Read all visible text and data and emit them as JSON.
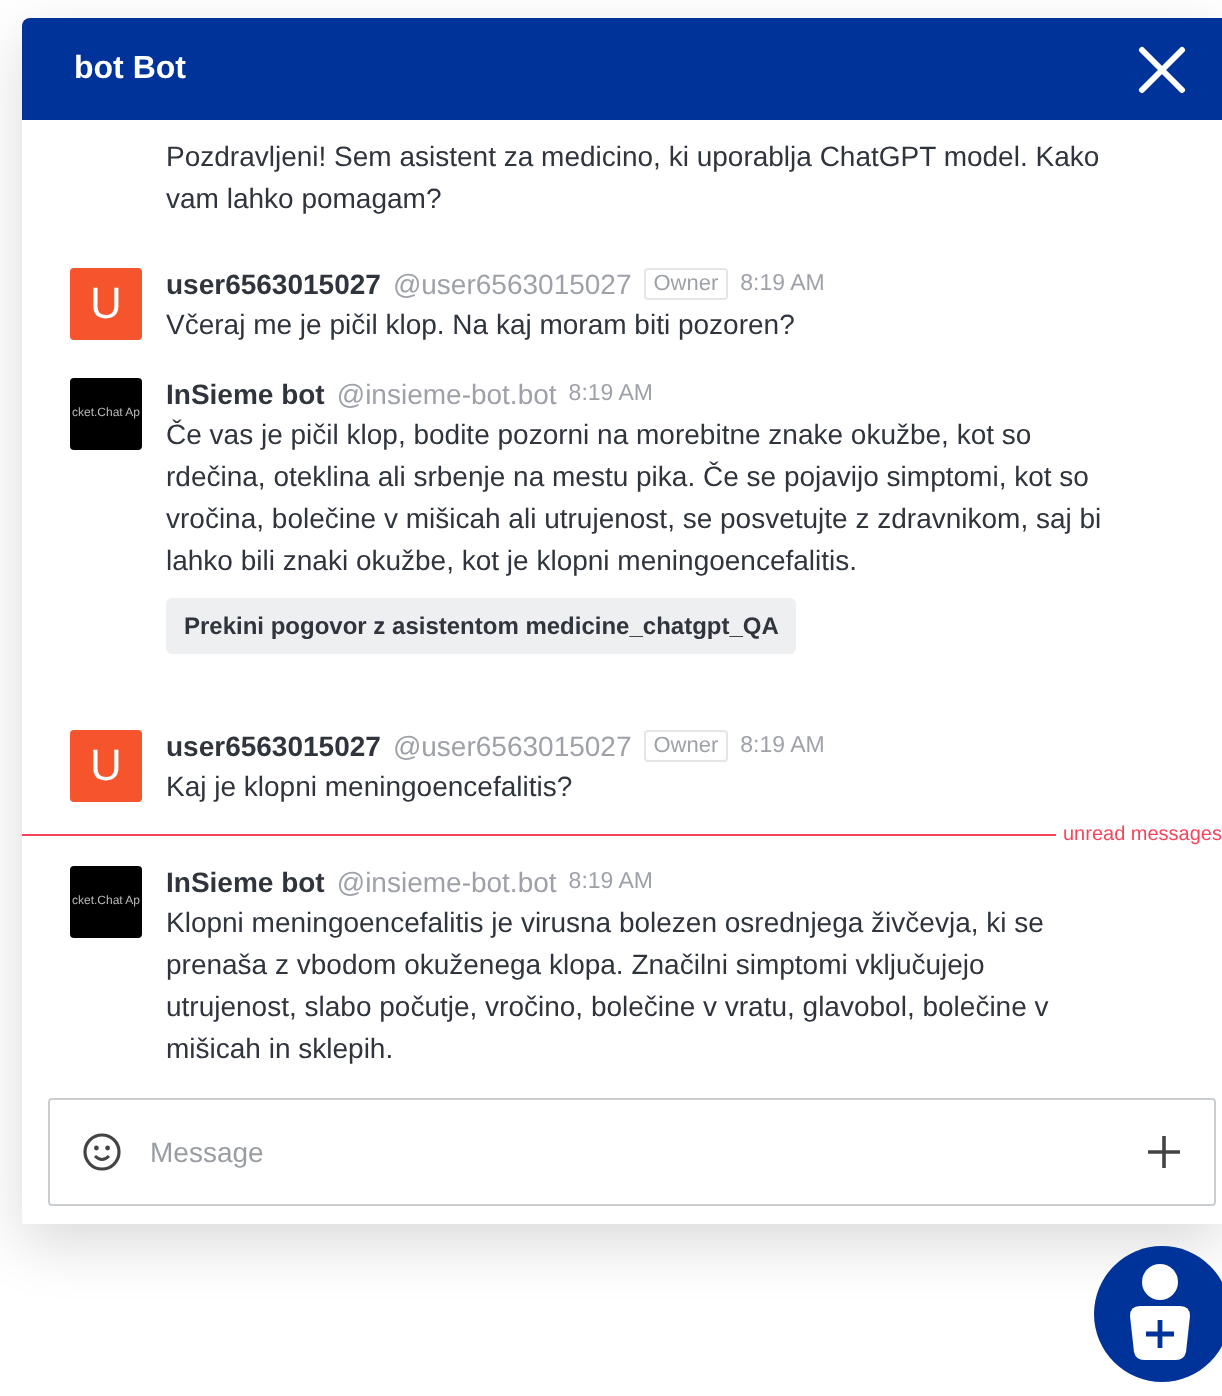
{
  "window": {
    "title": "bot Bot"
  },
  "messages": [
    {
      "kind": "continuation",
      "text": "Pozdravljeni! Sem asistent za medicino, ki uporablja ChatGPT model. Kako vam lahko pomagam?"
    },
    {
      "kind": "message",
      "avatar": {
        "kind": "letter",
        "text": "U"
      },
      "name": "user6563015027",
      "handle": "@user6563015027",
      "badge": "Owner",
      "time": "8:19 AM",
      "text": "Včeraj me je pičil klop. Na kaj moram biti pozoren?"
    },
    {
      "kind": "message",
      "avatar": {
        "kind": "image",
        "text": "cket.Chat Ap"
      },
      "name": "InSieme bot",
      "handle": "@insieme-bot.bot",
      "time": "8:19 AM",
      "text": "Če vas je pičil klop, bodite pozorni na morebitne znake okužbe, kot so rdečina, oteklina ali srbenje na mestu pika. Če se pojavijo simptomi, kot so vročina, bolečine v mišicah ali utrujenost, se posvetujte z zdravnikom, saj bi lahko bili znaki okužbe, kot je klopni meningoencefalitis.",
      "actions": [
        "Prekini pogovor z asistentom medicine_chatgpt_QA"
      ]
    },
    {
      "kind": "message",
      "avatar": {
        "kind": "letter",
        "text": "U"
      },
      "name": "user6563015027",
      "handle": "@user6563015027",
      "badge": "Owner",
      "time": "8:19 AM",
      "text": "Kaj je klopni meningoencefalitis?"
    },
    {
      "kind": "divider",
      "text": "unread messages"
    },
    {
      "kind": "message",
      "avatar": {
        "kind": "image",
        "text": "cket.Chat Ap"
      },
      "name": "InSieme bot",
      "handle": "@insieme-bot.bot",
      "time": "8:19 AM",
      "text": "Klopni meningoencefalitis je virusna bolezen osrednjega živčevja, ki se prenaša z vbodom okuženega klopa. Značilni simptomi vključujejo utrujenost, slabo počutje, vročino, bolečine v vratu, glavobol, bolečine v mišicah in sklepih."
    }
  ],
  "composer": {
    "placeholder": "Message"
  }
}
